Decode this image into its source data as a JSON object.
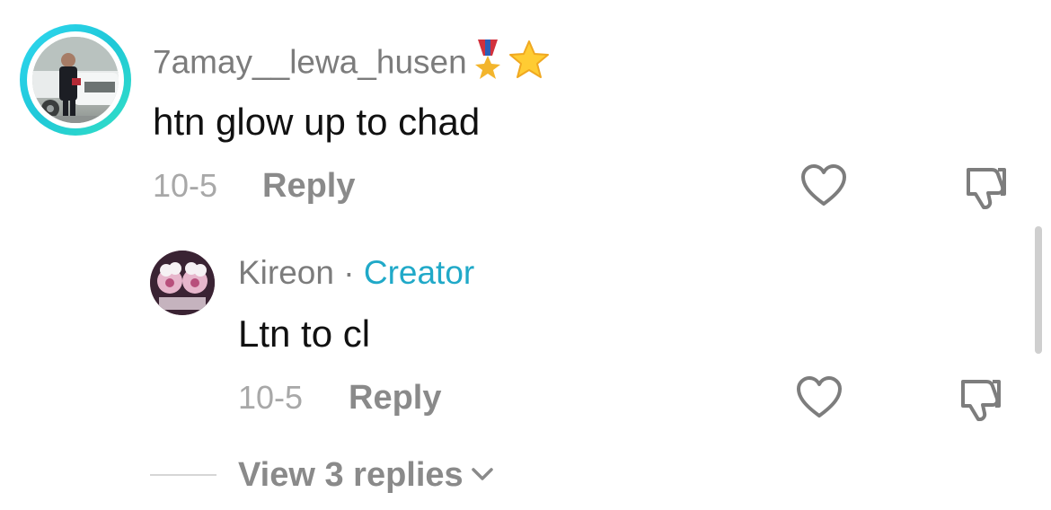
{
  "comment": {
    "username": "7amay__lewa_husen",
    "badges": [
      "military-medal-icon",
      "star-icon"
    ],
    "text": "htn glow up to chad",
    "date": "10-5",
    "reply_label": "Reply"
  },
  "reply": {
    "username": "Kireon",
    "separator": "·",
    "creator_label": "Creator",
    "text": "Ltn to cl",
    "date": "10-5",
    "reply_label": "Reply"
  },
  "view_replies_label": "View 3 replies",
  "colors": {
    "accent_ring": "#2fd7f0",
    "creator": "#20a9c8",
    "muted_text": "#7c7c7c",
    "date_text": "#a8a8a8"
  }
}
